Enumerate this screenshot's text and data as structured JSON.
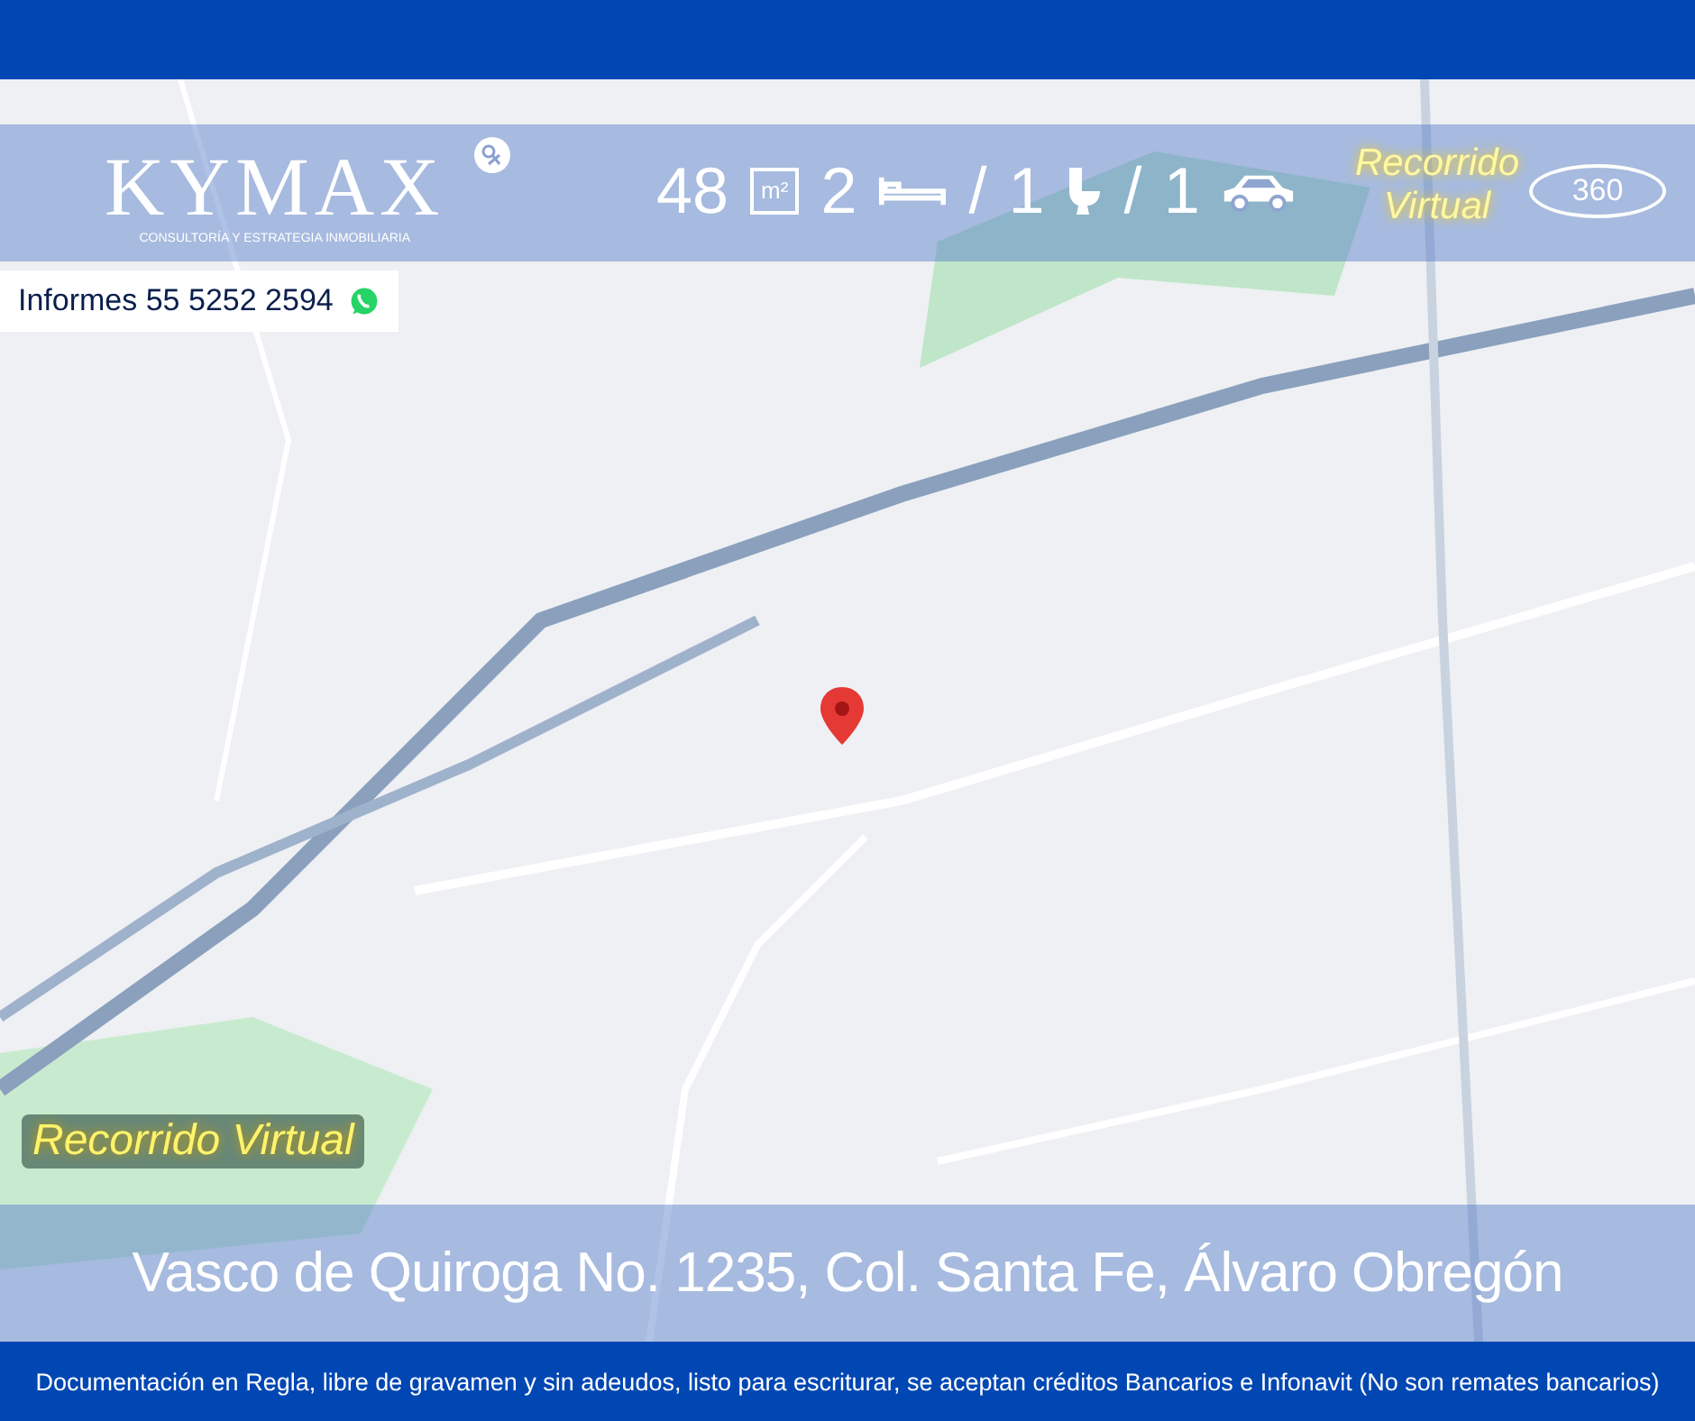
{
  "brand": {
    "name": "KYMAX",
    "tagline": "CONSULTORÍA Y ESTRATEGIA INMOBILIARIA"
  },
  "features": [
    {
      "kind": "area",
      "value": "48",
      "unit": "m²"
    },
    {
      "kind": "bedrooms",
      "value": "2"
    },
    {
      "kind": "bathrooms",
      "separator": "/",
      "value": "1"
    },
    {
      "kind": "parking",
      "separator": "/",
      "value": "1"
    }
  ],
  "virtual_tour": {
    "label": "Recorrido Virtual",
    "badge": "360"
  },
  "contact": {
    "label": "Informes 55 5252 2594"
  },
  "map_tour_label": "Recorrido Virtual",
  "address": "Vasco de Quiroga No. 1235, Col. Santa Fe, Álvaro Obregón",
  "footer": "Documentación en Regla, libre de gravamen y sin adeudos, listo para escriturar, se aceptan créditos Bancarios e Infonavit (No son remates bancarios)"
}
